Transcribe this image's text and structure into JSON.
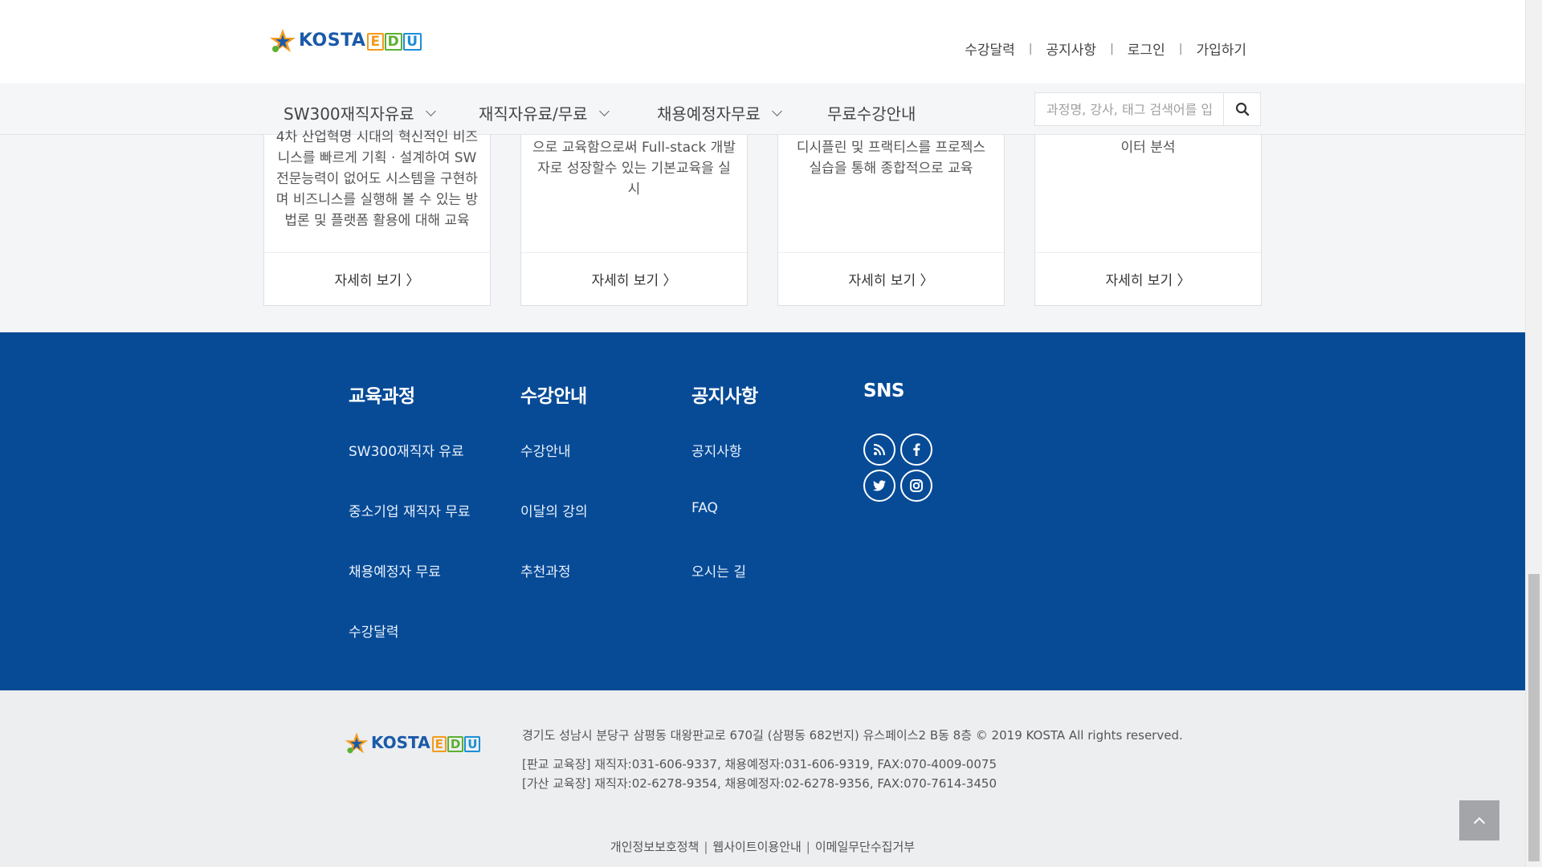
{
  "brand": {
    "name": "KOSTA",
    "suffix": [
      "E",
      "D",
      "U"
    ]
  },
  "util_nav": [
    "수강달력",
    "공지사항",
    "로그인",
    "가입하기"
  ],
  "gnb": [
    {
      "label": "SW300재직자유료",
      "dropdown": true
    },
    {
      "label": "재직자유료/무료",
      "dropdown": true
    },
    {
      "label": "채용예정자무료",
      "dropdown": true
    },
    {
      "label": "무료수강안내",
      "dropdown": false
    }
  ],
  "search": {
    "placeholder": "과정명, 강사, 태그 검색어를 입력하세요"
  },
  "cards": [
    {
      "desc": "4차 산업혁명 시대의 혁신적인 비즈니스를 빠르게 기획 · 설계하여 SW전문능력이 없어도 시스템을 구현하며 비즈니스를 실행해 볼 수 있는 방법론 및 플랫폼 활용에 대해 교육",
      "more": "자세히 보기 〉"
    },
    {
      "desc": "으로 교육함으로써 Full-stack 개발자로 성장할수 있는 기본교육을 실시",
      "more": "자세히 보기 〉"
    },
    {
      "desc": "디시플린 및 프랙티스를 프로젝스 실습을 통해 종합적으로 교육",
      "more": "자세히 보기 〉"
    },
    {
      "desc": "이터 분석",
      "more": "자세히 보기 〉"
    }
  ],
  "footer": {
    "columns": [
      {
        "title": "교육과정",
        "items": [
          "SW300재직자 유료",
          "중소기업 재직자 무료",
          "채용예정자 무료",
          "수강달력"
        ]
      },
      {
        "title": "수강안내",
        "items": [
          "수강안내",
          "이달의 강의",
          "추천과정"
        ]
      },
      {
        "title": "공지사항",
        "items": [
          "공지사항",
          "FAQ",
          "오시는 길"
        ]
      }
    ],
    "sns": {
      "title": "SNS",
      "icons": [
        "rss-icon",
        "facebook-icon",
        "twitter-icon",
        "instagram-icon"
      ]
    },
    "address": "경기도 성남시 분당구 삼평동 대왕판교로 670길 (삼평동 682번지) 유스페이스2 B동 8층 © 2019 KOSTA All rights reserved.",
    "pangyo": "[판교 교육장] 재직자:031-606-9337, 채용예정자:031-606-9319, FAX:070-4009-0075",
    "gasan": "[가산 교육장] 재직자:02-6278-9354, 채용예정자:02-6278-9356, FAX:070-7614-3450",
    "policies": [
      "개인정보보호정책",
      "웹사이트이용안내",
      "이메일무단수집거부"
    ]
  },
  "colors": {
    "footer_blue": "#074b97",
    "brand_blue": "#1b5aa8",
    "star_orange": "#f39a1e",
    "star_green": "#5bb031"
  }
}
